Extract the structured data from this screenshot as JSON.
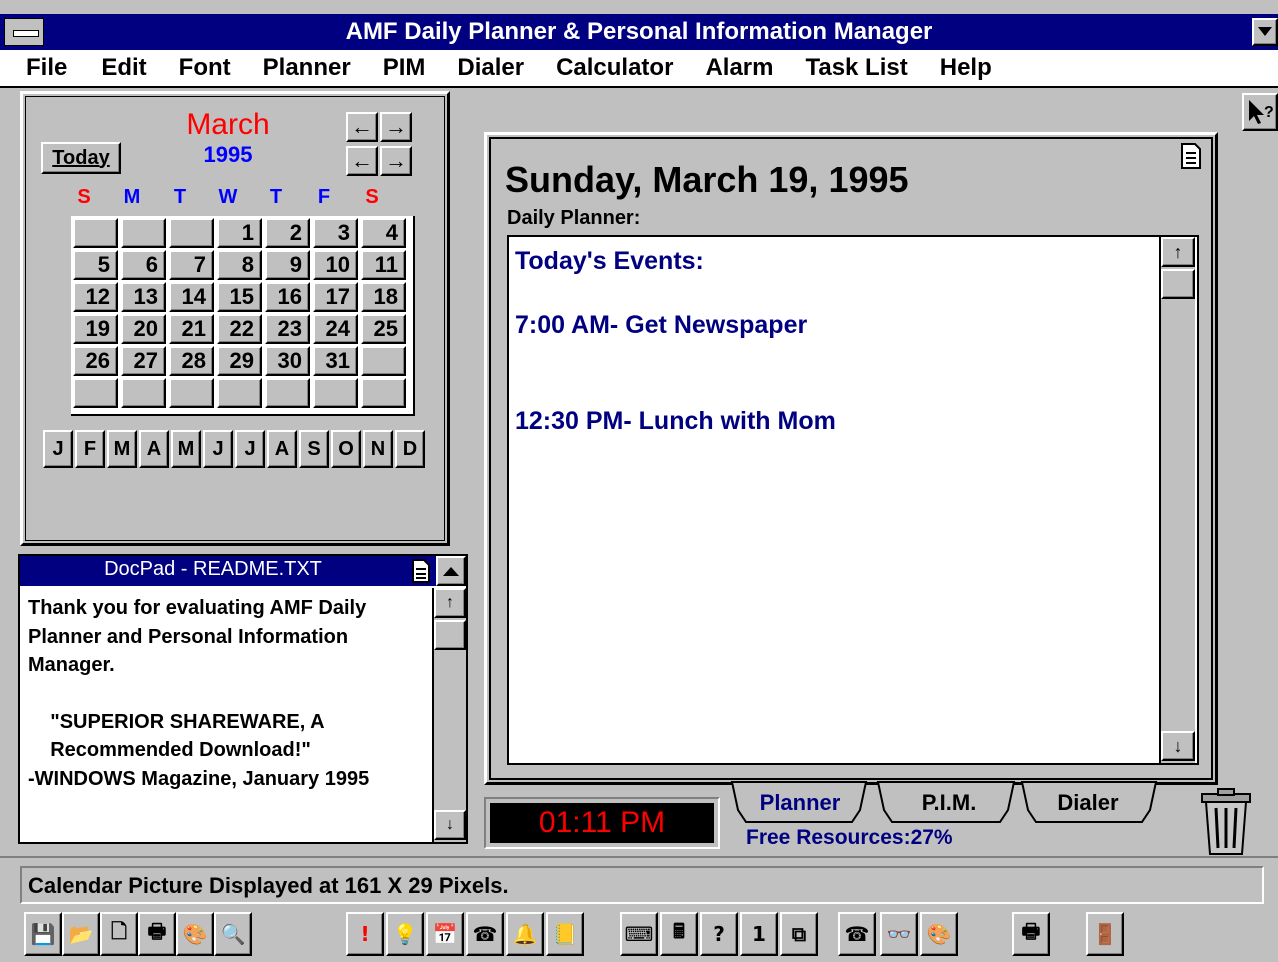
{
  "window": {
    "title": "AMF Daily Planner & Personal Information Manager"
  },
  "menu": [
    "File",
    "Edit",
    "Font",
    "Planner",
    "PIM",
    "Dialer",
    "Calculator",
    "Alarm",
    "Task List",
    "Help"
  ],
  "calendar": {
    "month": "March",
    "year": "1995",
    "today_label": "Today",
    "weekdays": [
      "S",
      "M",
      "T",
      "W",
      "T",
      "F",
      "S"
    ],
    "weeks": [
      [
        "",
        "",
        "",
        "1",
        "2",
        "3",
        "4"
      ],
      [
        "5",
        "6",
        "7",
        "8",
        "9",
        "10",
        "11"
      ],
      [
        "12",
        "13",
        "14",
        "15",
        "16",
        "17",
        "18"
      ],
      [
        "19",
        "20",
        "21",
        "22",
        "23",
        "24",
        "25"
      ],
      [
        "26",
        "27",
        "28",
        "29",
        "30",
        "31",
        ""
      ],
      [
        "",
        "",
        "",
        "",
        "",
        "",
        ""
      ]
    ],
    "months": [
      "J",
      "F",
      "M",
      "A",
      "M",
      "J",
      "J",
      "A",
      "S",
      "O",
      "N",
      "D"
    ],
    "colors": {
      "month": "#ff0000",
      "year": "#0000ff",
      "weekend": "#ff0000",
      "weekday": "#0000ff"
    }
  },
  "planner": {
    "date_heading": "Sunday, March 19, 1995",
    "label": "Daily Planner:",
    "events_heading": "Today's Events:",
    "events": [
      "7:00 AM- Get Newspaper",
      "12:30 PM- Lunch with Mom"
    ],
    "text_color": "#000080"
  },
  "docpad": {
    "title": "DocPad - README.TXT",
    "lines": [
      "Thank you for evaluating AMF Daily",
      "Planner and Personal Information",
      "Manager.",
      "",
      "    \"SUPERIOR SHAREWARE, A",
      "    Recommended Download!\"",
      "-WINDOWS Magazine, January 1995"
    ]
  },
  "clock": {
    "time": "01:11 PM",
    "color": "#ff0000"
  },
  "tabs": [
    "Planner",
    "P.I.M.",
    "Dialer"
  ],
  "free_resources": "Free Resources:27%",
  "status": {
    "text": "Calendar Picture Displayed at 161 X 29 Pixels."
  },
  "toolbar_icons": [
    "save-icon",
    "open-folder-icon",
    "new-document-icon",
    "print-icon",
    "palette-icon",
    "magnify-icon",
    "exclamation-icon",
    "lightbulb-icon",
    "calendar-task-icon",
    "phone-dial-icon",
    "bell-alarm-icon",
    "phone-book-icon",
    "typewriter-icon",
    "calculator-icon",
    "question-icon",
    "day-calendar-icon",
    "copy-pages-icon",
    "telephone-icon",
    "glasses-icon",
    "palette2-icon",
    "printer2-icon",
    "exit-door-icon"
  ]
}
